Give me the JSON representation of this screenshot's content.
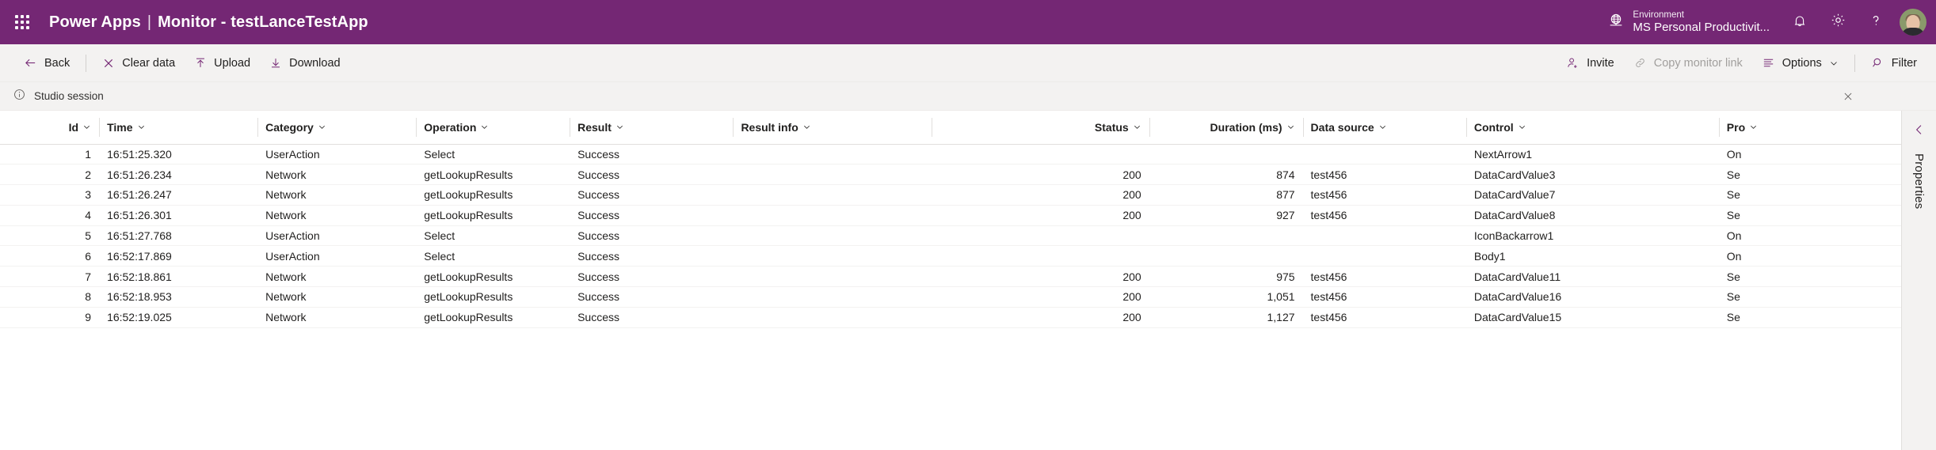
{
  "header": {
    "waffle_label": "App launcher",
    "product": "Power Apps",
    "separator": "|",
    "page_title": "Monitor - testLanceTestApp",
    "environment_label": "Environment",
    "environment_value": "MS Personal Productivit...",
    "icons": {
      "globe": "globe-icon",
      "notification": "bell-icon",
      "settings": "gear-icon",
      "help": "question-mark-icon",
      "avatar": "user-avatar"
    },
    "accent_color": "#742774"
  },
  "toolbar": {
    "back": "Back",
    "clear_data": "Clear data",
    "upload": "Upload",
    "download": "Download",
    "invite": "Invite",
    "copy_monitor_link": "Copy monitor link",
    "copy_monitor_link_disabled": true,
    "options": "Options",
    "filter": "Filter"
  },
  "session": {
    "text": "Studio session",
    "close_label": "Close"
  },
  "rail": {
    "label": "Properties",
    "collapse_label": "Collapse"
  },
  "table": {
    "columns": [
      {
        "key": "id",
        "label": "Id",
        "align": "right"
      },
      {
        "key": "time",
        "label": "Time",
        "align": "left"
      },
      {
        "key": "category",
        "label": "Category",
        "align": "left"
      },
      {
        "key": "operation",
        "label": "Operation",
        "align": "left"
      },
      {
        "key": "result",
        "label": "Result",
        "align": "left"
      },
      {
        "key": "result_info",
        "label": "Result info",
        "align": "left"
      },
      {
        "key": "status",
        "label": "Status",
        "align": "right"
      },
      {
        "key": "duration",
        "label": "Duration (ms)",
        "align": "right"
      },
      {
        "key": "data_source",
        "label": "Data source",
        "align": "left"
      },
      {
        "key": "control",
        "label": "Control",
        "align": "left"
      },
      {
        "key": "property",
        "label": "Pro",
        "align": "left"
      }
    ],
    "rows": [
      {
        "id": "1",
        "time": "16:51:25.320",
        "category": "UserAction",
        "operation": "Select",
        "result": "Success",
        "result_info": "",
        "status": "",
        "duration": "",
        "data_source": "",
        "control": "NextArrow1",
        "property": "On"
      },
      {
        "id": "2",
        "time": "16:51:26.234",
        "category": "Network",
        "operation": "getLookupResults",
        "result": "Success",
        "result_info": "",
        "status": "200",
        "duration": "874",
        "data_source": "test456",
        "control": "DataCardValue3",
        "property": "Se"
      },
      {
        "id": "3",
        "time": "16:51:26.247",
        "category": "Network",
        "operation": "getLookupResults",
        "result": "Success",
        "result_info": "",
        "status": "200",
        "duration": "877",
        "data_source": "test456",
        "control": "DataCardValue7",
        "property": "Se"
      },
      {
        "id": "4",
        "time": "16:51:26.301",
        "category": "Network",
        "operation": "getLookupResults",
        "result": "Success",
        "result_info": "",
        "status": "200",
        "duration": "927",
        "data_source": "test456",
        "control": "DataCardValue8",
        "property": "Se"
      },
      {
        "id": "5",
        "time": "16:51:27.768",
        "category": "UserAction",
        "operation": "Select",
        "result": "Success",
        "result_info": "",
        "status": "",
        "duration": "",
        "data_source": "",
        "control": "IconBackarrow1",
        "property": "On"
      },
      {
        "id": "6",
        "time": "16:52:17.869",
        "category": "UserAction",
        "operation": "Select",
        "result": "Success",
        "result_info": "",
        "status": "",
        "duration": "",
        "data_source": "",
        "control": "Body1",
        "property": "On"
      },
      {
        "id": "7",
        "time": "16:52:18.861",
        "category": "Network",
        "operation": "getLookupResults",
        "result": "Success",
        "result_info": "",
        "status": "200",
        "duration": "975",
        "data_source": "test456",
        "control": "DataCardValue11",
        "property": "Se"
      },
      {
        "id": "8",
        "time": "16:52:18.953",
        "category": "Network",
        "operation": "getLookupResults",
        "result": "Success",
        "result_info": "",
        "status": "200",
        "duration": "1,051",
        "data_source": "test456",
        "control": "DataCardValue16",
        "property": "Se"
      },
      {
        "id": "9",
        "time": "16:52:19.025",
        "category": "Network",
        "operation": "getLookupResults",
        "result": "Success",
        "result_info": "",
        "status": "200",
        "duration": "1,127",
        "data_source": "test456",
        "control": "DataCardValue15",
        "property": "Se"
      }
    ]
  }
}
